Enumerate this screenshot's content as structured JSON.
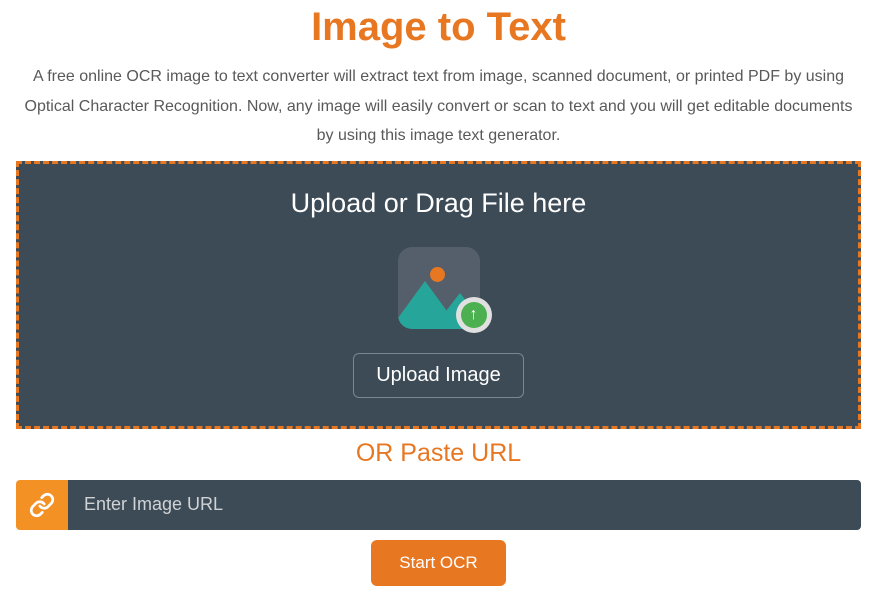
{
  "header": {
    "title": "Image to Text",
    "description": "A free online OCR image to text converter will extract text from image, scanned document, or printed PDF by using Optical Character Recognition. Now, any image will easily convert or scan to text and you will get editable documents by using this image text generator."
  },
  "dropzone": {
    "title": "Upload or Drag File here",
    "button_label": "Upload Image"
  },
  "url_section": {
    "label": "OR Paste URL",
    "placeholder": "Enter Image URL",
    "value": ""
  },
  "actions": {
    "start_label": "Start OCR"
  }
}
